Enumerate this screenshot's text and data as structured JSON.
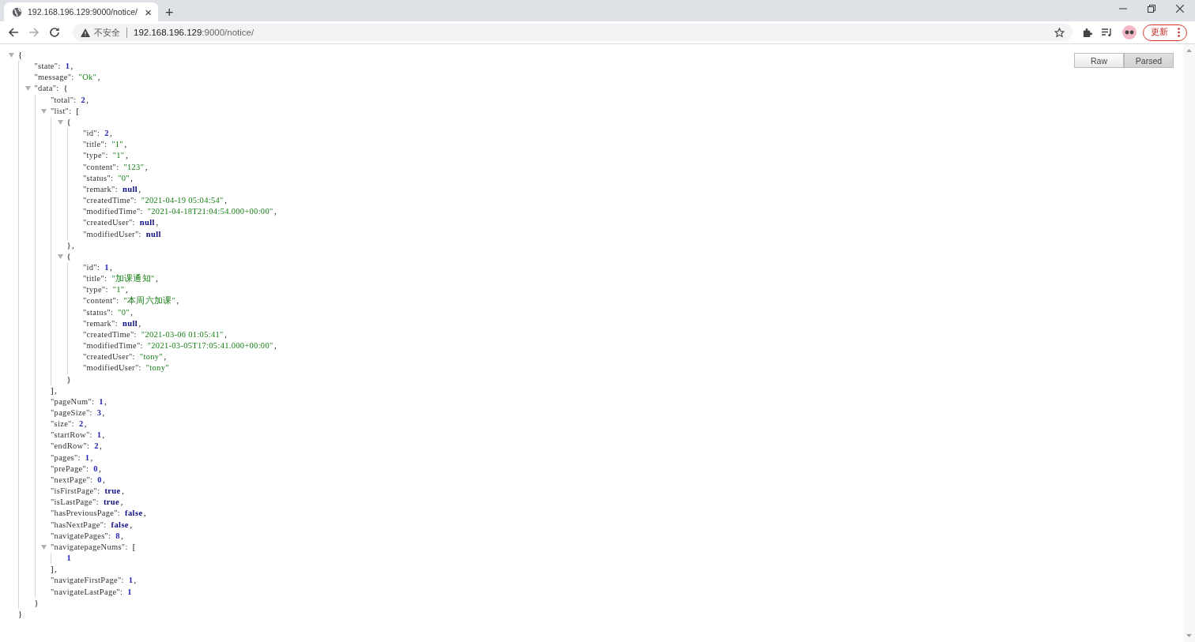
{
  "tab": {
    "title": "192.168.196.129:9000/notice/",
    "close": "×"
  },
  "new_tab": "+",
  "address": {
    "security": "不安全",
    "host": "192.168.196.129",
    "path": ":9000/notice/"
  },
  "update_button": "更新",
  "view_buttons": [
    {
      "label": "Raw",
      "selected": false
    },
    {
      "label": "Parsed",
      "selected": true
    }
  ],
  "json": {
    "open": "{",
    "close": "}",
    "expanded": true,
    "children": [
      {
        "key": "\"state\":",
        "value": "1",
        "kind": "number",
        "comma": ","
      },
      {
        "key": "\"message\":",
        "value": "\"Ok\"",
        "kind": "string",
        "comma": ","
      },
      {
        "key": "\"data\":",
        "open": "{",
        "close": "}",
        "expanded": true,
        "children": [
          {
            "key": "\"total\":",
            "value": "2",
            "kind": "number",
            "comma": ","
          },
          {
            "key": "\"list\":",
            "open": "[",
            "close": "]",
            "comma": ",",
            "expanded": true,
            "children": [
              {
                "open": "{",
                "close": "}",
                "comma": ",",
                "expanded": true,
                "children": [
                  {
                    "key": "\"id\":",
                    "value": "2",
                    "kind": "number",
                    "comma": ","
                  },
                  {
                    "key": "\"title\":",
                    "value": "\"1\"",
                    "kind": "string",
                    "comma": ","
                  },
                  {
                    "key": "\"type\":",
                    "value": "\"1\"",
                    "kind": "string",
                    "comma": ","
                  },
                  {
                    "key": "\"content\":",
                    "value": "\"123\"",
                    "kind": "string",
                    "comma": ","
                  },
                  {
                    "key": "\"status\":",
                    "value": "\"0\"",
                    "kind": "string",
                    "comma": ","
                  },
                  {
                    "key": "\"remark\":",
                    "value": "null",
                    "kind": "literal",
                    "comma": ","
                  },
                  {
                    "key": "\"createdTime\":",
                    "value": "\"2021-04-19 05:04:54\"",
                    "kind": "string",
                    "comma": ","
                  },
                  {
                    "key": "\"modifiedTime\":",
                    "value": "\"2021-04-18T21:04:54.000+00:00\"",
                    "kind": "string",
                    "comma": ","
                  },
                  {
                    "key": "\"createdUser\":",
                    "value": "null",
                    "kind": "literal",
                    "comma": ","
                  },
                  {
                    "key": "\"modifiedUser\":",
                    "value": "null",
                    "kind": "literal"
                  }
                ]
              },
              {
                "open": "{",
                "close": "}",
                "expanded": true,
                "children": [
                  {
                    "key": "\"id\":",
                    "value": "1",
                    "kind": "number",
                    "comma": ","
                  },
                  {
                    "key": "\"title\":",
                    "value": "\"加课通知\"",
                    "kind": "string",
                    "comma": ","
                  },
                  {
                    "key": "\"type\":",
                    "value": "\"1\"",
                    "kind": "string",
                    "comma": ","
                  },
                  {
                    "key": "\"content\":",
                    "value": "\"本周六加课\"",
                    "kind": "string",
                    "comma": ","
                  },
                  {
                    "key": "\"status\":",
                    "value": "\"0\"",
                    "kind": "string",
                    "comma": ","
                  },
                  {
                    "key": "\"remark\":",
                    "value": "null",
                    "kind": "literal",
                    "comma": ","
                  },
                  {
                    "key": "\"createdTime\":",
                    "value": "\"2021-03-06 01:05:41\"",
                    "kind": "string",
                    "comma": ","
                  },
                  {
                    "key": "\"modifiedTime\":",
                    "value": "\"2021-03-05T17:05:41.000+00:00\"",
                    "kind": "string",
                    "comma": ","
                  },
                  {
                    "key": "\"createdUser\":",
                    "value": "\"tony\"",
                    "kind": "string",
                    "comma": ","
                  },
                  {
                    "key": "\"modifiedUser\":",
                    "value": "\"tony\"",
                    "kind": "string"
                  }
                ]
              }
            ]
          },
          {
            "key": "\"pageNum\":",
            "value": "1",
            "kind": "number",
            "comma": ","
          },
          {
            "key": "\"pageSize\":",
            "value": "3",
            "kind": "number",
            "comma": ","
          },
          {
            "key": "\"size\":",
            "value": "2",
            "kind": "number",
            "comma": ","
          },
          {
            "key": "\"startRow\":",
            "value": "1",
            "kind": "number",
            "comma": ","
          },
          {
            "key": "\"endRow\":",
            "value": "2",
            "kind": "number",
            "comma": ","
          },
          {
            "key": "\"pages\":",
            "value": "1",
            "kind": "number",
            "comma": ","
          },
          {
            "key": "\"prePage\":",
            "value": "0",
            "kind": "number",
            "comma": ","
          },
          {
            "key": "\"nextPage\":",
            "value": "0",
            "kind": "number",
            "comma": ","
          },
          {
            "key": "\"isFirstPage\":",
            "value": "true",
            "kind": "literal",
            "comma": ","
          },
          {
            "key": "\"isLastPage\":",
            "value": "true",
            "kind": "literal",
            "comma": ","
          },
          {
            "key": "\"hasPreviousPage\":",
            "value": "false",
            "kind": "literal",
            "comma": ","
          },
          {
            "key": "\"hasNextPage\":",
            "value": "false",
            "kind": "literal",
            "comma": ","
          },
          {
            "key": "\"navigatePages\":",
            "value": "8",
            "kind": "number",
            "comma": ","
          },
          {
            "key": "\"navigatepageNums\":",
            "open": "[",
            "close": "]",
            "comma": ",",
            "expanded": true,
            "children": [
              {
                "value": "1",
                "kind": "number"
              }
            ]
          },
          {
            "key": "\"navigateFirstPage\":",
            "value": "1",
            "kind": "number",
            "comma": ","
          },
          {
            "key": "\"navigateLastPage\":",
            "value": "1",
            "kind": "number"
          }
        ]
      }
    ]
  }
}
